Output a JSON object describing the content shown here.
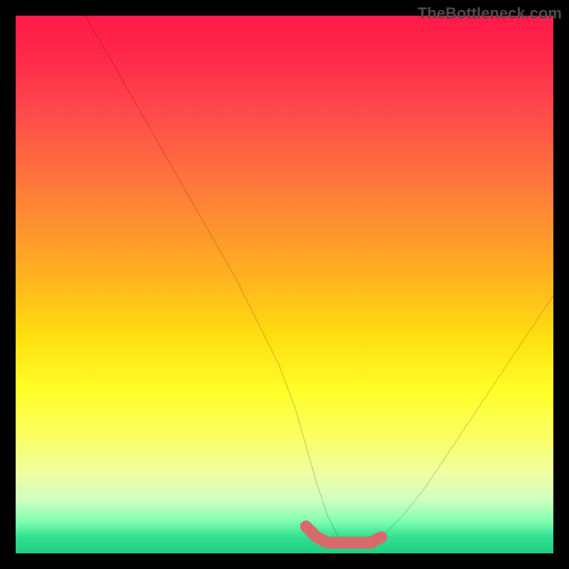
{
  "watermark": "TheBottleneck.com",
  "chart_data": {
    "type": "line",
    "title": "",
    "xlabel": "",
    "ylabel": "",
    "xlim": [
      0,
      100
    ],
    "ylim": [
      0,
      100
    ],
    "series": [
      {
        "name": "bottleneck-curve",
        "x": [
          13,
          17,
          21,
          25,
          29,
          33,
          37,
          41,
          45,
          49,
          52,
          54,
          56,
          58,
          60,
          62,
          64,
          66,
          68,
          72,
          76,
          80,
          84,
          88,
          92,
          96,
          100
        ],
        "values": [
          100,
          93,
          86,
          79,
          72,
          65,
          58,
          51,
          43,
          35,
          27,
          20,
          13,
          7,
          3,
          2,
          2,
          2,
          3,
          7,
          12,
          18,
          24,
          30,
          36,
          42,
          48
        ]
      },
      {
        "name": "optimal-region",
        "x": [
          54,
          56,
          58,
          60,
          62,
          64,
          66,
          68
        ],
        "values": [
          5,
          3,
          2,
          2,
          2,
          2,
          2,
          3
        ]
      }
    ],
    "colors": {
      "top": "#ff1a4a",
      "mid": "#ffe010",
      "bottom": "#20d080",
      "curve": "#000000",
      "optimal": "#d86a6a"
    }
  }
}
